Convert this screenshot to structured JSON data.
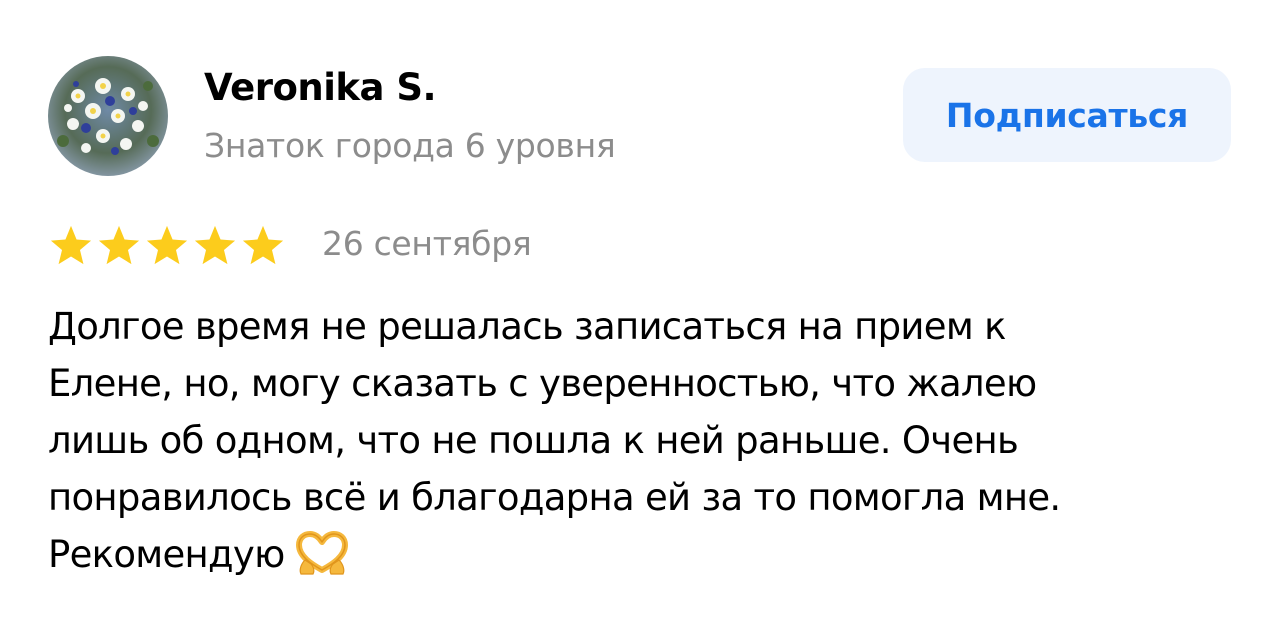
{
  "author": {
    "name": "Veronika S.",
    "level": "Знаток города 6 уровня",
    "avatar_icon": "daisy-bouquet-photo"
  },
  "actions": {
    "subscribe_label": "Подписаться"
  },
  "review": {
    "rating": 5,
    "rating_max": 5,
    "star_color": "#fccc1c",
    "date": "26 сентября",
    "text_lines": [
      "Долгое время не решалась записаться на прием к",
      "Елене, но, могу сказать с уверенностью, что жалею",
      "лишь об одном, что не пошла к ней раньше. Очень",
      "понравилось всё и благодарна ей за то помогла мне.",
      "Рекомендую"
    ],
    "emoji_icon": "heart-hands-icon"
  },
  "colors": {
    "accent": "#1a73e8",
    "button_bg": "#eef4fd",
    "secondary_text": "#8c8c8c"
  }
}
